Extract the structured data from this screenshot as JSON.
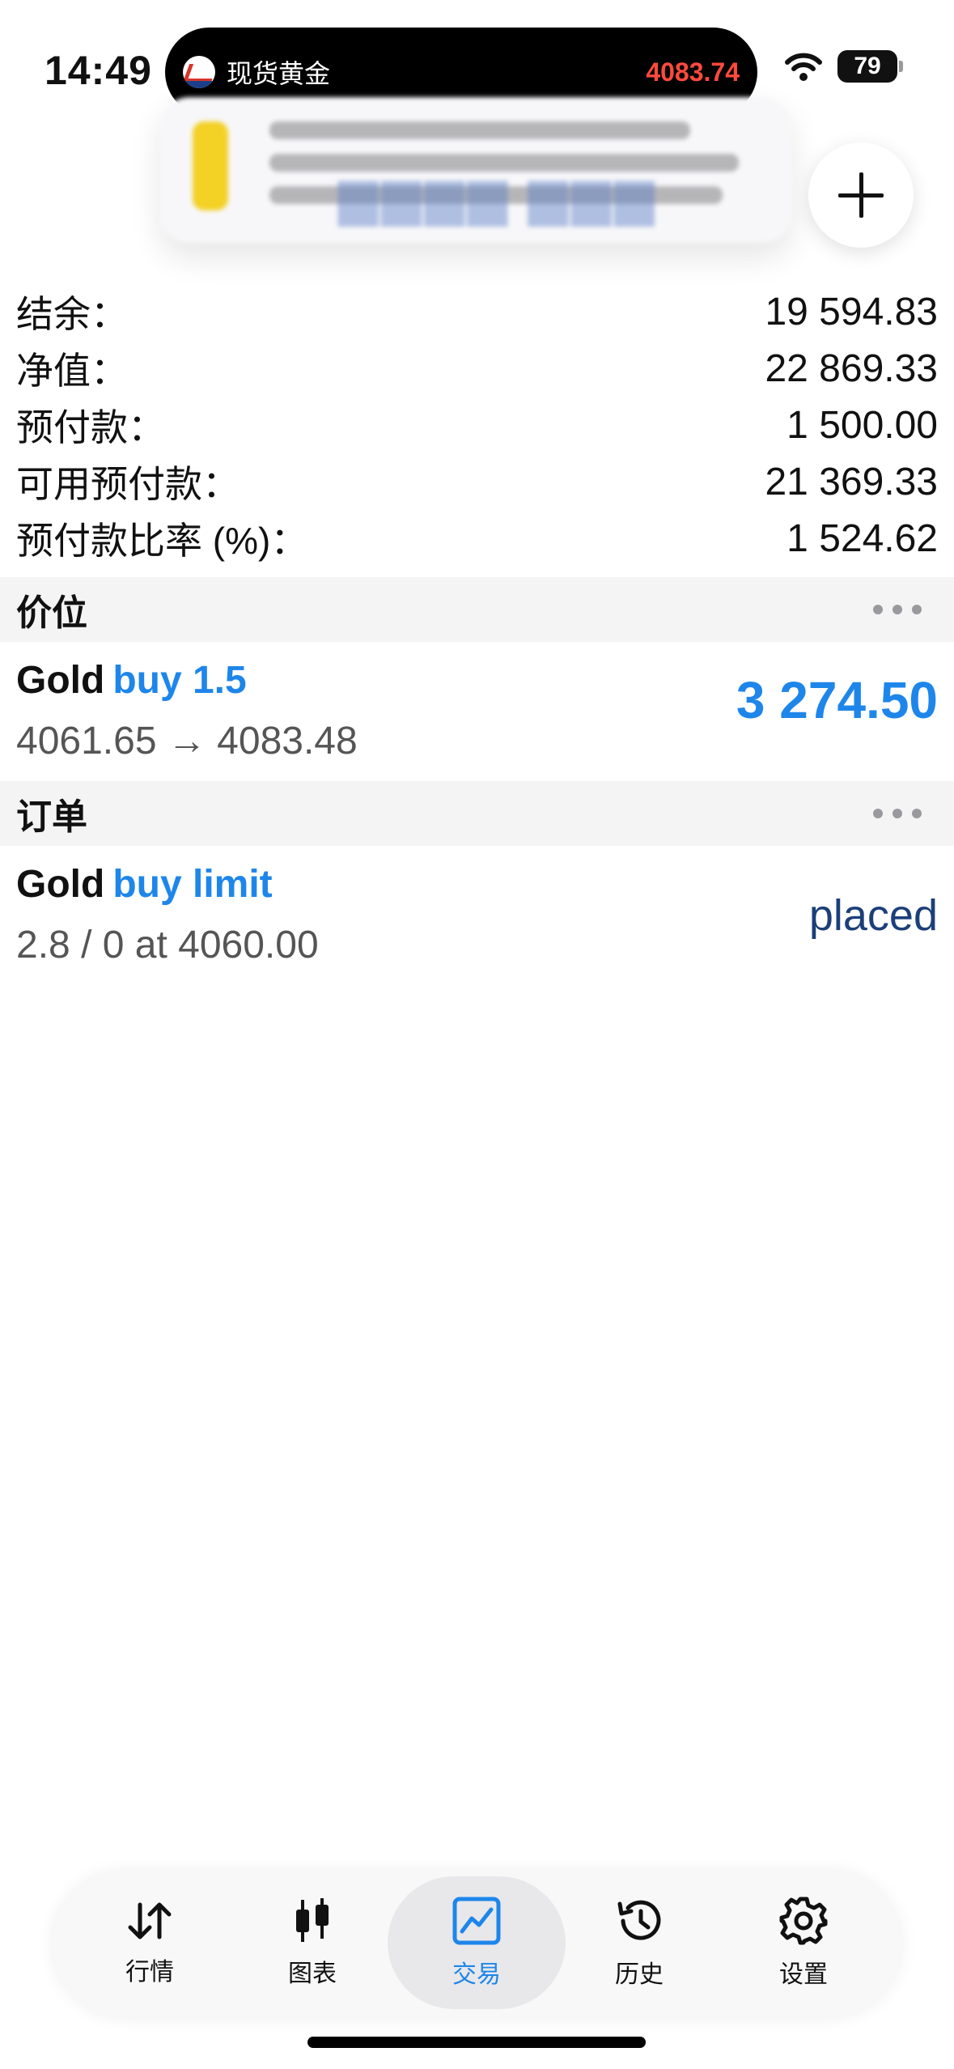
{
  "status_bar": {
    "time": "14:49",
    "island_title": "现货黄金",
    "island_price": "4083.74",
    "battery": "79"
  },
  "account": {
    "rows": [
      {
        "label": "结余：",
        "value": "19 594.83"
      },
      {
        "label": "净值：",
        "value": "22 869.33"
      },
      {
        "label": "预付款：",
        "value": "1 500.00"
      },
      {
        "label": "可用预付款：",
        "value": "21 369.33"
      },
      {
        "label": "预付款比率 (%)：",
        "value": "1 524.62"
      }
    ]
  },
  "positions": {
    "title": "价位",
    "item": {
      "symbol": "Gold",
      "side": "buy 1.5",
      "prices": "4061.65 → 4083.48",
      "profit": "3 274.50"
    }
  },
  "orders": {
    "title": "订单",
    "item": {
      "symbol": "Gold",
      "side": "buy limit",
      "detail": "2.8 / 0 at 4060.00",
      "state": "placed"
    }
  },
  "tabs": [
    {
      "label": "行情",
      "icon": "arrows-up-down-icon"
    },
    {
      "label": "图表",
      "icon": "candlestick-icon"
    },
    {
      "label": "交易",
      "icon": "trade-chart-icon",
      "active": true
    },
    {
      "label": "历史",
      "icon": "history-icon"
    },
    {
      "label": "设置",
      "icon": "gear-icon"
    }
  ],
  "colors": {
    "accent": "#1e86ea",
    "island_price": "#ff4a3d",
    "order_state": "#1c3f7a"
  }
}
